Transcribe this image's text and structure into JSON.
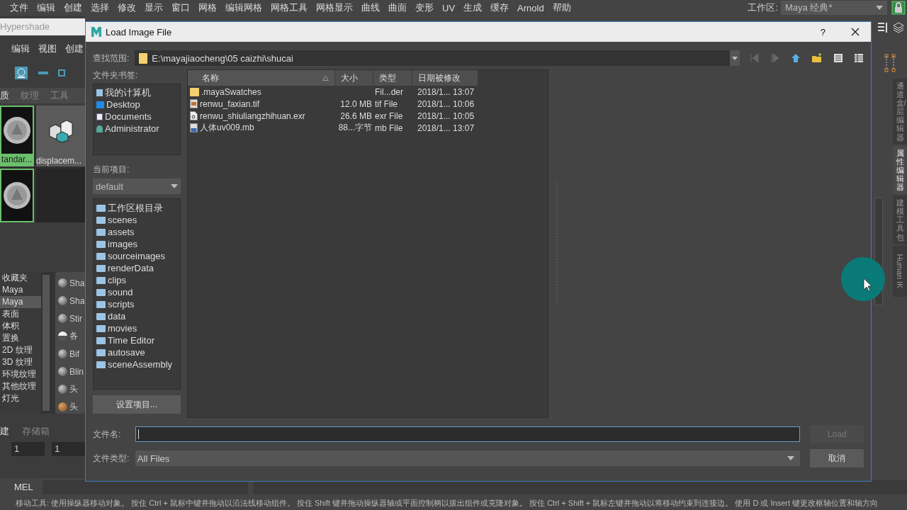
{
  "menu_bar": {
    "items": [
      "文件",
      "编辑",
      "创建",
      "选择",
      "修改",
      "显示",
      "窗口",
      "网格",
      "编辑网格",
      "网格工具",
      "网格显示",
      "曲线",
      "曲面",
      "变形",
      "UV",
      "生成",
      "缓存",
      "Arnold",
      "帮助"
    ],
    "workspace_label": "工作区:",
    "workspace_value": "Maya 经典*"
  },
  "hypershade": {
    "title": "Hypershade",
    "menu": [
      "编辑",
      "视图",
      "创建"
    ],
    "tabs": [
      {
        "label": "质",
        "selected": true
      },
      {
        "label": "纹理",
        "selected": false
      },
      {
        "label": "工具",
        "selected": false
      }
    ],
    "swatches": [
      {
        "label": "tandar...",
        "kind": "sphere",
        "selected": true
      },
      {
        "label": "displacem...",
        "kind": "cubes",
        "selected": false
      },
      {
        "kind": "sphere",
        "selected": true
      },
      {
        "kind": "empty",
        "selected": false
      }
    ],
    "tree": [
      {
        "label": "收藏夹",
        "selected": false
      },
      {
        "label": "Maya",
        "selected": false
      },
      {
        "label": "Maya",
        "selected": true
      },
      {
        "label": "表面",
        "selected": false
      },
      {
        "label": "体积",
        "selected": false
      },
      {
        "label": "置换",
        "selected": false
      },
      {
        "label": "2D 纹理",
        "selected": false
      },
      {
        "label": "3D 纹理",
        "selected": false
      },
      {
        "label": "环境纹理",
        "selected": false
      },
      {
        "label": "其他纹理",
        "selected": false
      },
      {
        "label": "灯光",
        "selected": false
      }
    ],
    "nodes": [
      {
        "label": "Sha",
        "kind": "sphere"
      },
      {
        "label": "Sha",
        "kind": "sphere"
      },
      {
        "label": "Stir",
        "kind": "sphere"
      },
      {
        "label": "各",
        "kind": "half"
      },
      {
        "label": "Bif",
        "kind": "sphere"
      },
      {
        "label": "Blin",
        "kind": "sphere"
      },
      {
        "label": "头",
        "kind": "sphere"
      },
      {
        "label": "头",
        "kind": "hair"
      }
    ],
    "bottom_tabs": [
      {
        "label": "建",
        "selected": true
      },
      {
        "label": "存储箱",
        "selected": false
      }
    ],
    "fields": [
      "1",
      "1"
    ]
  },
  "right_tabs": [
    {
      "label": "通道盒/层编辑器",
      "kind": "cjk",
      "selected": false
    },
    {
      "label": "属性编辑器",
      "kind": "cjk",
      "selected": true
    },
    {
      "label": "建模工具包",
      "kind": "cjk",
      "selected": false
    },
    {
      "label": "Human IK",
      "kind": "latin",
      "selected": false
    }
  ],
  "command_line": {
    "label": "MEL"
  },
  "status_line": "移动工具: 使用操纵器移动对象。 按住 Ctrl + 鼠标中键并拖动以沿法线移动组件。 按住 Shift 键并拖动操纵器轴或平面控制柄以拔出组件或克隆对象。 按住 Ctrl + Shift + 鼠标左键并拖动以将移动约束到连接边。 使用 D 或 Insert 键更改枢轴位置和轴方向",
  "dialog": {
    "title": "Load Image File",
    "help": "?",
    "look_in": {
      "label": "查找范围:",
      "path": "E:\\mayajiaocheng\\05 caizhi\\shucai"
    },
    "bookmarks": {
      "label": "文件夹书签:",
      "items": [
        {
          "label": "我的计算机",
          "kind": "computer"
        },
        {
          "label": "Desktop",
          "kind": "desktop"
        },
        {
          "label": "Documents",
          "kind": "documents"
        },
        {
          "label": "Administrator",
          "kind": "user"
        }
      ]
    },
    "project": {
      "label": "当前项目:",
      "value": "default"
    },
    "project_folders": [
      "工作区根目录",
      "scenes",
      "assets",
      "images",
      "sourceimages",
      "renderData",
      "clips",
      "sound",
      "scripts",
      "data",
      "movies",
      "Time Editor",
      "autosave",
      "sceneAssembly"
    ],
    "set_project_button": "设置项目...",
    "columns": [
      {
        "label": "名称",
        "sorted": true
      },
      {
        "label": "大小",
        "sorted": false
      },
      {
        "label": "类型",
        "sorted": false
      },
      {
        "label": "日期被修改",
        "sorted": false
      }
    ],
    "files": [
      {
        "name": ".mayaSwatches",
        "type": "Fil...der",
        "date": "2018/1... 13:07",
        "kind": "folder"
      },
      {
        "name": "renwu_faxian.tif",
        "size": "12.0 MB",
        "type": "tif File",
        "date": "2018/1... 10:06",
        "kind": "image"
      },
      {
        "name": "renwu_shiuliangzhihuan.exr",
        "size": "26.6 MB",
        "type": "exr File",
        "date": "2018/1... 10:05",
        "kind": "doc"
      },
      {
        "name": "人体uv009.mb",
        "size": "88...字节",
        "type": "mb File",
        "date": "2018/1... 13:07",
        "kind": "mb"
      }
    ],
    "file_name": {
      "label": "文件名:"
    },
    "load_button": {
      "label": "Load",
      "disabled": true
    },
    "file_type": {
      "label": "文件类型:",
      "value": "All Files"
    },
    "cancel_button": {
      "label": "取消"
    }
  }
}
